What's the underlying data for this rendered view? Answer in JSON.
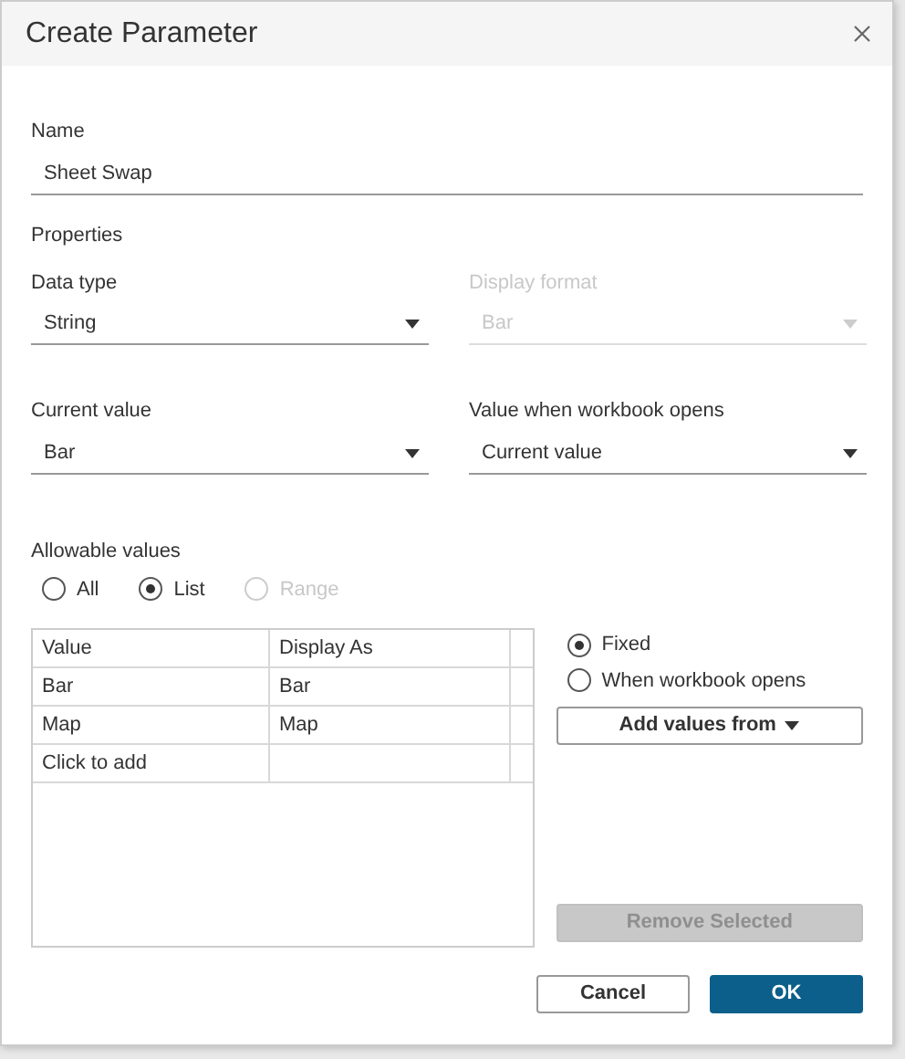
{
  "window": {
    "title": "Create Parameter"
  },
  "name_field": {
    "label": "Name",
    "value": "Sheet Swap"
  },
  "properties": {
    "heading": "Properties"
  },
  "dropdowns": [
    {
      "label": "Data type",
      "value": "String",
      "disabled": false
    },
    {
      "label": "Display format",
      "value": "Bar",
      "disabled": true
    },
    {
      "label": "Current value",
      "value": "Bar",
      "disabled": false
    },
    {
      "label": "Value when workbook opens",
      "value": "Current value",
      "disabled": false
    }
  ],
  "allowable_values": {
    "label": "Allowable values",
    "options": [
      {
        "label": "All",
        "selected": false,
        "disabled": false
      },
      {
        "label": "List",
        "selected": true,
        "disabled": false
      },
      {
        "label": "Range",
        "selected": false,
        "disabled": true
      }
    ]
  },
  "table": {
    "columns": [
      "Value",
      "Display As"
    ],
    "rows": [
      [
        "Bar",
        "Bar"
      ],
      [
        "Map",
        "Map"
      ]
    ],
    "add_row": "Click to add"
  },
  "list_options": [
    {
      "label": "Fixed",
      "selected": true
    },
    {
      "label": "When workbook opens",
      "selected": false
    }
  ],
  "add_values_button": {
    "label": "Add values from"
  },
  "remove_button": {
    "label": "Remove Selected",
    "disabled": true
  },
  "buttons": [
    {
      "label": "Cancel",
      "kind": "secondary"
    },
    {
      "label": "OK",
      "kind": "primary"
    }
  ]
}
